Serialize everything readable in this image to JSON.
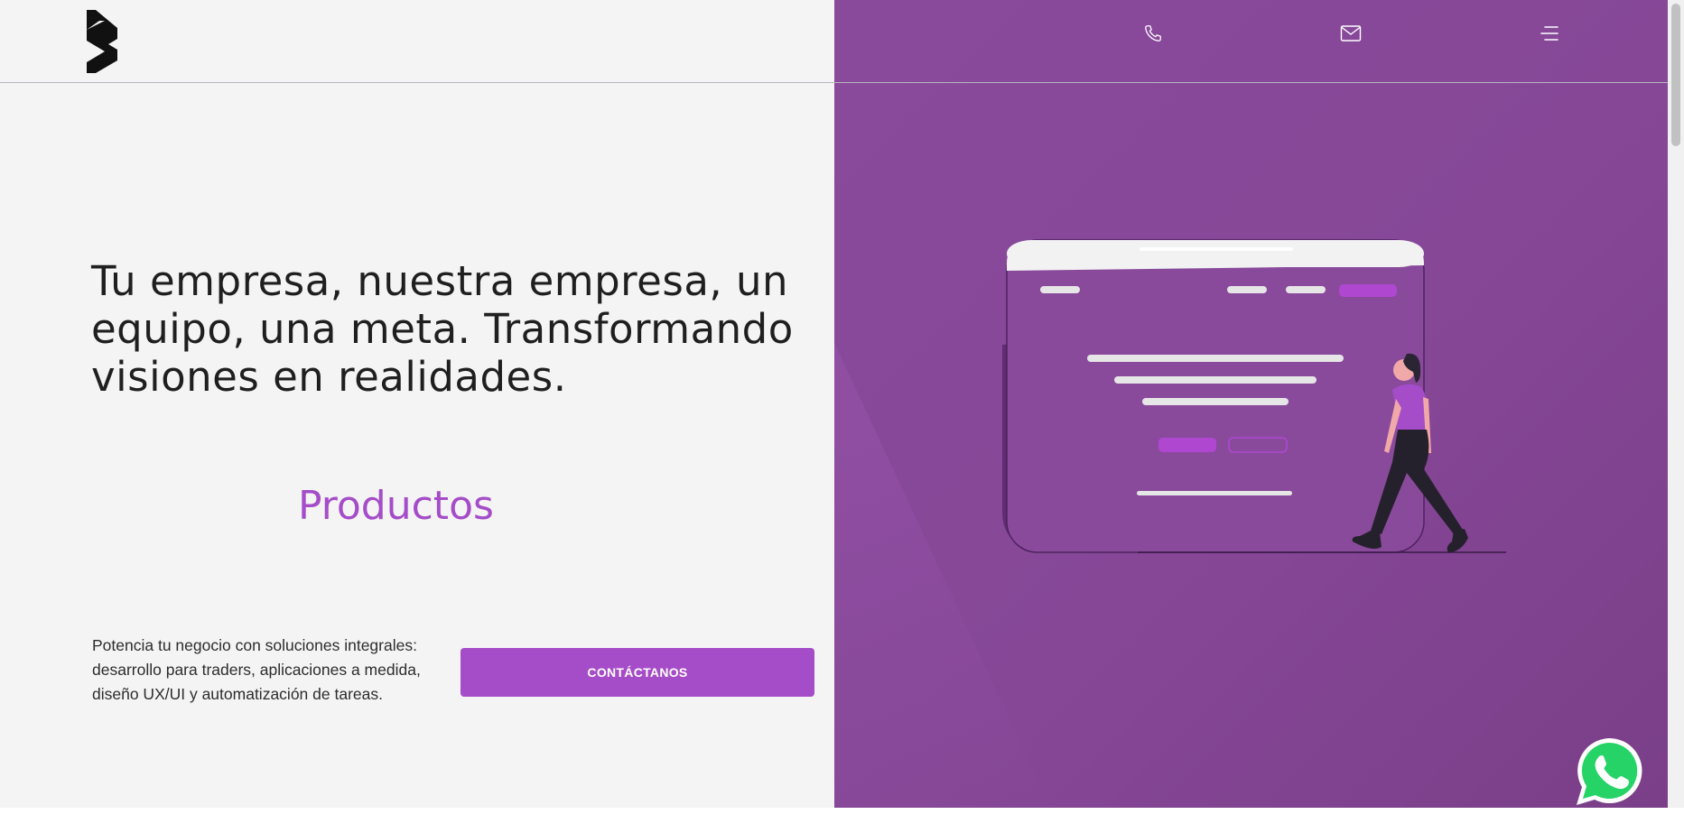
{
  "brand": {
    "logo_icon": "brand-logo-icon"
  },
  "header": {
    "icons": [
      "phone-icon",
      "mail-icon",
      "hamburger-menu-icon"
    ]
  },
  "hero": {
    "headline": "Tu empresa, nuestra empresa, un equipo, una meta. Transformando visiones en realidades.",
    "section_title": "Productos",
    "description": "Potencia tu negocio con soluciones integrales: desarrollo para traders, aplicaciones a medida, diseño UX/UI y automatización de tareas.",
    "cta_label": "CONTÁCTANOS"
  },
  "floating": {
    "whatsapp_icon": "whatsapp-icon"
  },
  "colors": {
    "accent": "#a54cc8",
    "right_panel": "#864797",
    "left_panel": "#f4f4f4",
    "text": "#1f1f1f"
  }
}
